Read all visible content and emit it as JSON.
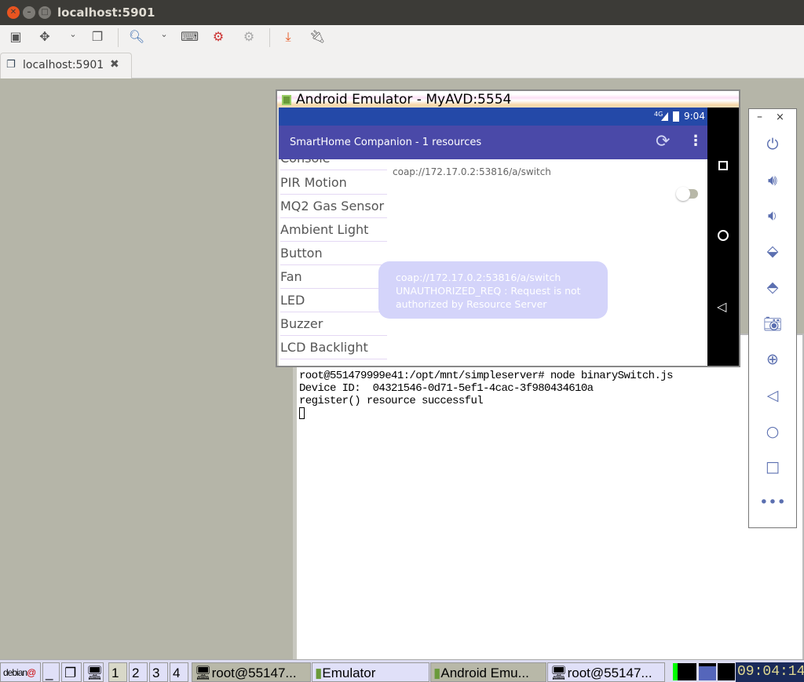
{
  "window": {
    "title": "localhost:5901",
    "tab_label": "localhost:5901"
  },
  "toolbar": {
    "icons": [
      "fullscreen-icon",
      "scale-icon",
      "chevron-down-icon",
      "windows-icon",
      "zoom-icon",
      "chevron-down-icon",
      "keyboard-icon",
      "preferences-icon",
      "options-icon",
      "transfer-icon",
      "disconnect-icon"
    ]
  },
  "terminal": {
    "lines": [
      "root@551479999e41:/opt/mnt/simpleserver# node binarySwitch.js",
      "Device ID:  04321546-0d71-5ef1-4cac-3f980434610a",
      "register() resource successful"
    ]
  },
  "emulator": {
    "title": "Android Emulator - MyAVD:5554",
    "status_time": "9:04",
    "network": "4G",
    "app_title": "SmartHome Companion - 1 resources",
    "list": [
      "Console",
      "PIR Motion",
      "MQ2 Gas Sensor",
      "Ambient Light",
      "Button",
      "Fan",
      "LED",
      "Buzzer",
      "LCD Backlight"
    ],
    "resource_uri": "coap://172.17.0.2:53816/a/switch",
    "switch_on": false,
    "toast": [
      "coap://172.17.0.2:53816/a/switch",
      "UNAUTHORIZED_REQ : Request is not authorized by Resource Server"
    ]
  },
  "taskbar": {
    "logo": "debian",
    "workspaces": [
      "1",
      "2",
      "3",
      "4"
    ],
    "tasks": [
      "root@55147...",
      "Emulator",
      "Android Emu...",
      "root@55147..."
    ],
    "clock": "09:04:14"
  }
}
